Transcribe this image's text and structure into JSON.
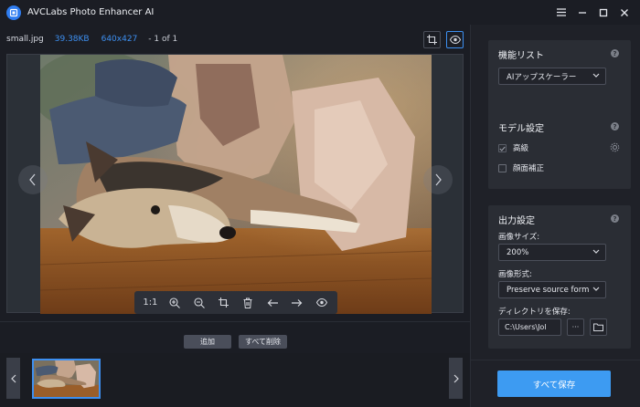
{
  "app": {
    "title": "AVCLabs Photo Enhancer AI",
    "accent": "#3d8ff0"
  },
  "window_controls": {
    "menu": "≡",
    "minimize": "–",
    "maximize": "□",
    "close": "✕"
  },
  "file": {
    "name": "small.jpg",
    "size": "39.38KB",
    "dimensions": "640x427",
    "page": "- 1 of 1"
  },
  "toolbar": {
    "ratio": "1:1"
  },
  "actions": {
    "add": "追加",
    "delete_all": "すべて削除"
  },
  "features": {
    "title": "機能リスト",
    "selected": "AIアップスケーラー"
  },
  "model": {
    "title": "モデル設定",
    "options": [
      {
        "label": "高級",
        "checked": true
      },
      {
        "label": "顔面補正",
        "checked": false
      }
    ]
  },
  "output": {
    "title": "出力設定",
    "size_label": "画像サイズ:",
    "size_value": "200%",
    "format_label": "画像形式:",
    "format_value": "Preserve source format",
    "dir_label": "ディレクトリを保存:",
    "dir_value": "C:\\Users\\Jol",
    "browse": "···"
  },
  "save_all": "すべて保存"
}
